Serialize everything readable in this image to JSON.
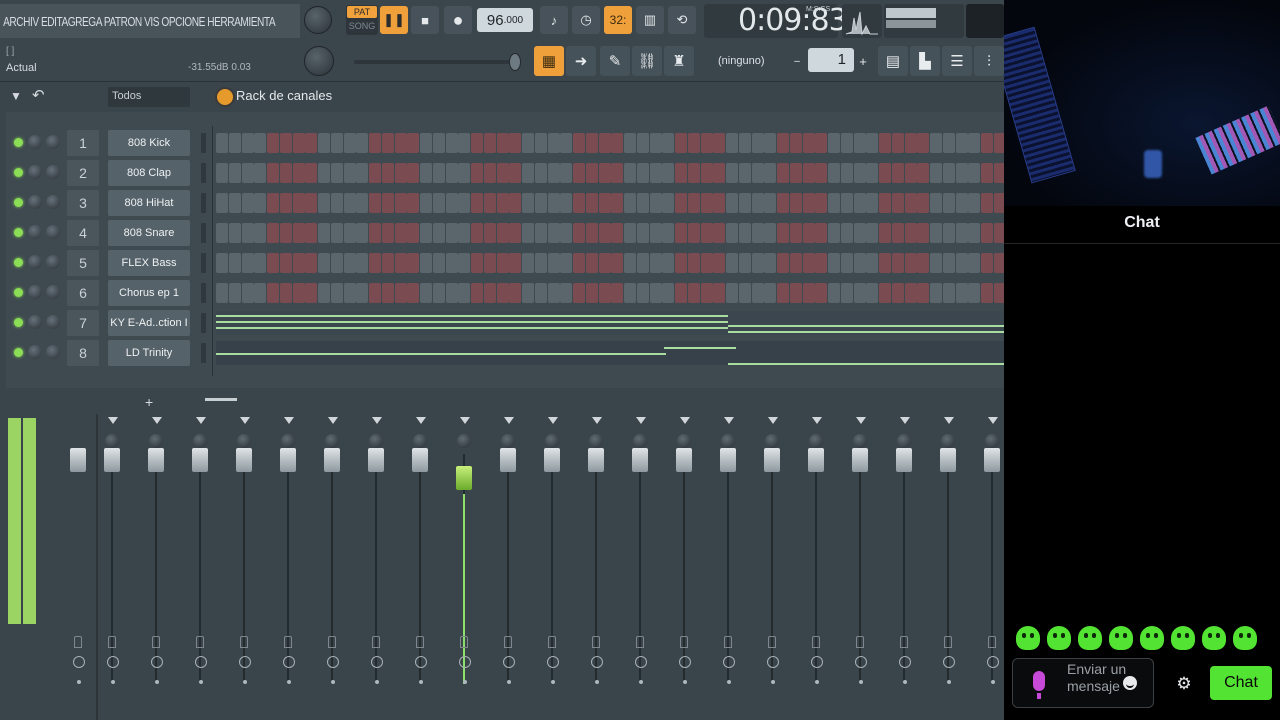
{
  "menu": {
    "text": "ARCHIV EDITAGREGA PATRON  VIS OPCIONE HERRAMIENTA"
  },
  "hint": {
    "brackets": "[  ]",
    "label": "Actual",
    "db": "-31.55dB  0.03"
  },
  "transport": {
    "pat": "PAT",
    "song": "SONG",
    "pause_icon": "❚❚",
    "stop_icon": "■",
    "record_icon": "●",
    "tempo": "96",
    "tempo_decimal": ".000",
    "time": "0:09:83",
    "time_mode": "M:S:CS",
    "snap": "32:"
  },
  "toolbar": {
    "pattern_select": "(ninguno)",
    "pattern_number": "1",
    "plus": "+",
    "minus": "–"
  },
  "rack": {
    "title": "Rack de canales",
    "filter": "Todos",
    "channels": [
      {
        "num": "1",
        "name": "808 Kick"
      },
      {
        "num": "2",
        "name": "808 Clap"
      },
      {
        "num": "3",
        "name": "808 HiHat"
      },
      {
        "num": "4",
        "name": "808 Snare"
      },
      {
        "num": "5",
        "name": "FLEX Bass"
      },
      {
        "num": "6",
        "name": "Chorus ep 1"
      },
      {
        "num": "7",
        "name": "KY E-Ad..ction I"
      },
      {
        "num": "8",
        "name": "LD Trinity"
      }
    ],
    "add": "+"
  },
  "chat": {
    "title": "Chat",
    "placeholder": "Enviar un mensaje",
    "send": "Chat",
    "settings_icon": "⚙"
  },
  "colors": {
    "accent": "#f0a03a",
    "step_red": "#7a4c51",
    "step_gray": "#5a656c",
    "green": "#53e332"
  },
  "icons": [
    "play-icon",
    "stop-icon",
    "record-icon",
    "settings-icon",
    "mic-icon",
    "emote-icon"
  ]
}
